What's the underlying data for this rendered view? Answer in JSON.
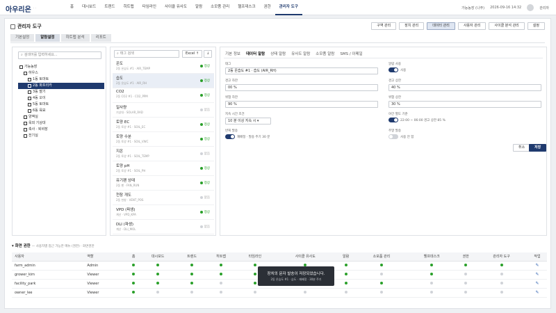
{
  "app": {
    "name": "아우리온",
    "sub": "· ·"
  },
  "nav": [
    "홈",
    "대시보드",
    "트렌드",
    "히트맵",
    "타임라인",
    "사이클 유사도",
    "알람",
    "소모품 관리",
    "헬프데스크",
    "권한",
    "관리자 도구"
  ],
  "nav_active": 10,
  "topright": {
    "farm": "가능농장 (나주)",
    "datetime": "2026-09-16 14:32",
    "user": "관리자"
  },
  "page": {
    "title": "관리자 도구"
  },
  "actions": [
    "구역 관리",
    "장치 관리",
    "데이터 관리",
    "사용자 관리",
    "사이클 분석 관리",
    "설정"
  ],
  "actions_active": 2,
  "tabs": [
    "기본설정",
    "알람설정",
    "히트맵 분석",
    "리포트"
  ],
  "tabs_active": 1,
  "tree": {
    "search_placeholder": "검색어를 입력하세요...",
    "nodes": [
      {
        "label": "가능농장",
        "depth": 0,
        "selected": false
      },
      {
        "label": "하우스",
        "depth": 1,
        "selected": false
      },
      {
        "label": "1동 토마토",
        "depth": 2,
        "selected": false
      },
      {
        "label": "2동 파프리카",
        "depth": 2,
        "selected": true
      },
      {
        "label": "3동 딸기",
        "depth": 2,
        "selected": false
      },
      {
        "label": "4동 오이",
        "depth": 2,
        "selected": false
      },
      {
        "label": "5동 토마토",
        "depth": 2,
        "selected": false
      },
      {
        "label": "6동 육묘",
        "depth": 2,
        "selected": false
      },
      {
        "label": "양액실",
        "depth": 1,
        "selected": false
      },
      {
        "label": "옥외 기상대",
        "depth": 1,
        "selected": false
      },
      {
        "label": "축사 · 퇴비장",
        "depth": 1,
        "selected": false
      },
      {
        "label": "전기실",
        "depth": 1,
        "selected": false
      }
    ]
  },
  "taglist": {
    "search_placeholder": "태그 검색",
    "excel_label": "Excel ↑",
    "download_label": "↓",
    "items": [
      {
        "name": "온도",
        "sub": "2동 온습도 #1 · AIR_TEMP",
        "status": "정상",
        "active": true,
        "selected": false
      },
      {
        "name": "습도",
        "sub": "2동 온습도 #1 · AIR_RH",
        "status": "정상",
        "active": true,
        "selected": true
      },
      {
        "name": "CO2",
        "sub": "2동 CO2 #1 · CO2_PPM",
        "status": "정상",
        "active": true,
        "selected": false
      },
      {
        "name": "일사량",
        "sub": "기상대 · SOLAR_RAD",
        "status": "없음",
        "active": false,
        "selected": false
      },
      {
        "name": "토양 EC",
        "sub": "2동 토양 #1 · SOIL_EC",
        "status": "정상",
        "active": true,
        "selected": false
      },
      {
        "name": "토양 수분",
        "sub": "2동 토양 #1 · SOIL_VWC",
        "status": "정상",
        "active": true,
        "selected": false
      },
      {
        "name": "지온",
        "sub": "2동 토양 #1 · SOIL_TEMP",
        "status": "없음",
        "active": false,
        "selected": false
      },
      {
        "name": "토양 pH",
        "sub": "2동 토양 #1 · SOIL_PH",
        "status": "정상",
        "active": true,
        "selected": false
      },
      {
        "name": "유기팬 상태",
        "sub": "2동 팬 · FAN_RUN",
        "status": "정상",
        "active": true,
        "selected": false
      },
      {
        "name": "천창 개도",
        "sub": "2동 천창 · VENT_POS",
        "status": "없음",
        "active": false,
        "selected": false
      },
      {
        "name": "VPD (파생)",
        "sub": "계산 · VPD_KPA",
        "status": "정상",
        "active": true,
        "selected": false
      },
      {
        "name": "DLI (파생)",
        "sub": "계산 · DLI_MOL",
        "status": "없음",
        "active": false,
        "selected": false
      }
    ]
  },
  "detail": {
    "subtabs": [
      "기본 정보",
      "데이터 알람",
      "상태 알람",
      "유사도 알람",
      "소모품 알람",
      "SMS / 이메일"
    ],
    "subtabs_active": 1,
    "tag_label": "태그",
    "tag_value": "2동 온습도 #1 · 습도 (AIR_RH)",
    "alarm_use_label": "알람 사용",
    "alarm_use_text": "사용",
    "warn_low_label": "경고 하한",
    "warn_low_value": "00 %",
    "warn_high_label": "경고 상한",
    "warn_high_value": "40 %",
    "danger_low_label": "위험 하한",
    "danger_low_value": "90 %",
    "danger_high_label": "위험 상한",
    "danger_high_value": "30 %",
    "duration_label": "지속 시간 조건",
    "duration_value": "10 분 이상 지속 시",
    "night_label": "야간 별도 기준",
    "night_text": "22:00 ~ 06:00 경고 상한 85 %",
    "repeat_label": "반복 발송",
    "repeat_text": "재배정 · 발송 주기 30 분",
    "weekend_label": "주말 발송",
    "weekend_text": "사용 안 함",
    "cancel_label": "취소",
    "save_label": "저장"
  },
  "perm": {
    "title": "▾ 화면 권한",
    "note": "— 사용자별 접근 가능한 메뉴 (권한) · 화면권한",
    "headers": [
      "사용자",
      "역할",
      "홈",
      "대시보드",
      "트렌드",
      "히트맵",
      "타임라인",
      "사이클 유사도",
      "알람",
      "소모품 관리",
      "헬프데스크",
      "권한",
      "관리자 도구",
      "작업"
    ],
    "rows": [
      {
        "user": "farm_admin",
        "role": "Admin",
        "perms": [
          1,
          1,
          1,
          1,
          1,
          1,
          1,
          1,
          1,
          1,
          1
        ]
      },
      {
        "user": "grower_kim",
        "role": "Viewer",
        "perms": [
          1,
          1,
          1,
          1,
          1,
          1,
          1,
          0,
          1,
          0,
          0
        ]
      },
      {
        "user": "facility_park",
        "role": "Viewer",
        "perms": [
          1,
          1,
          1,
          0,
          1,
          1,
          1,
          1,
          0,
          0,
          0
        ]
      },
      {
        "user": "owner_lee",
        "role": "Viewer",
        "perms": [
          1,
          0,
          0,
          0,
          0,
          0,
          0,
          0,
          0,
          0,
          0
        ]
      }
    ]
  },
  "toast": {
    "title": "장치의 문자 발송이 저장되었습니다.",
    "sub": "2동 온습도 #1 · 습도 · 재배정 · 30분 주기"
  }
}
